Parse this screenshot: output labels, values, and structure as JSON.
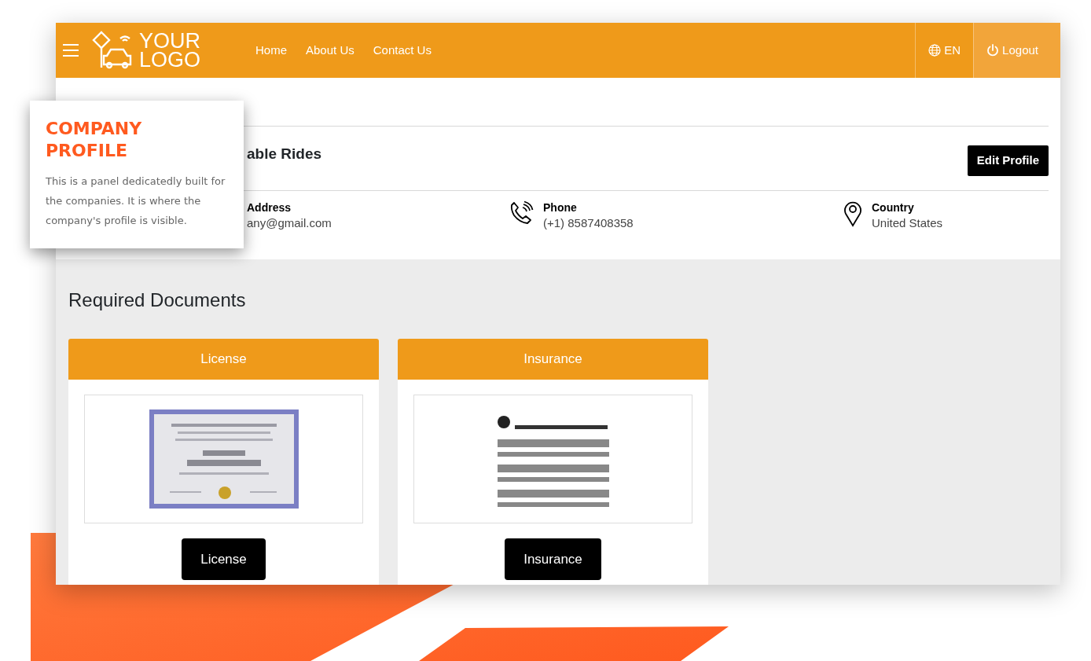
{
  "header": {
    "logo_lines": [
      "YOUR",
      "LOGO"
    ],
    "nav_links": [
      "Home",
      "About Us",
      "Contact Us"
    ],
    "language": "EN",
    "logout": "Logout"
  },
  "callout": {
    "title": "COMPANY PROFILE",
    "text": "This is a panel dedicatedly built for the companies. It is where the company's profile is visible."
  },
  "profile": {
    "rides_title": "able Rides",
    "edit_button": "Edit Profile",
    "info": [
      {
        "kind": "plain",
        "label": "Address",
        "value": "any@gmail.com"
      },
      {
        "kind": "phone",
        "label": "Phone",
        "value": "(+1) 8587408358"
      },
      {
        "kind": "location",
        "label": "Country",
        "value": "United States"
      }
    ]
  },
  "documents": {
    "title": "Required Documents",
    "cards": [
      {
        "title": "License",
        "button": "License"
      },
      {
        "title": "Insurance",
        "button": "Insurance"
      }
    ]
  }
}
